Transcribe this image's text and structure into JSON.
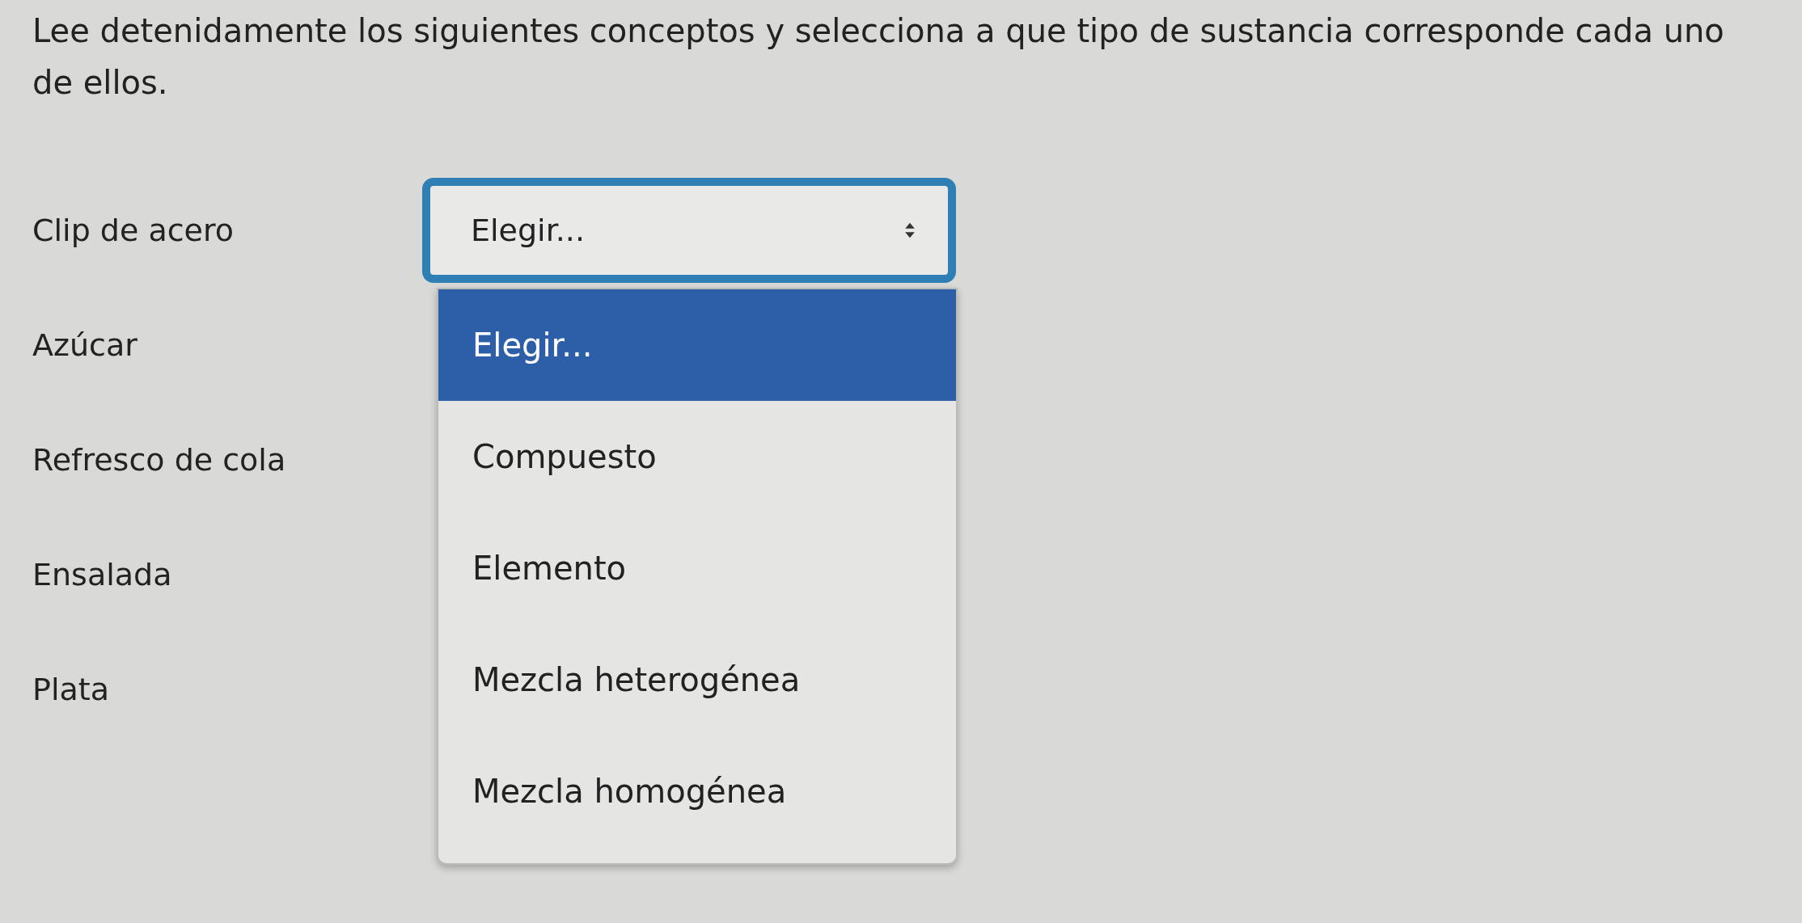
{
  "instructions": "Lee detenidamente los siguientes conceptos y selecciona a que tipo de sustancia corresponde cada uno de ellos.",
  "questions": [
    {
      "label": "Clip de acero",
      "select": {
        "value": "Elegir...",
        "expanded": true,
        "options": [
          {
            "label": "Elegir...",
            "selected": true
          },
          {
            "label": "Compuesto",
            "selected": false
          },
          {
            "label": "Elemento",
            "selected": false
          },
          {
            "label": "Mezcla heterogénea",
            "selected": false
          },
          {
            "label": "Mezcla homogénea",
            "selected": false
          }
        ]
      }
    },
    {
      "label": "Azúcar"
    },
    {
      "label": "Refresco de cola"
    },
    {
      "label": "Ensalada"
    },
    {
      "label": "Plata"
    }
  ]
}
